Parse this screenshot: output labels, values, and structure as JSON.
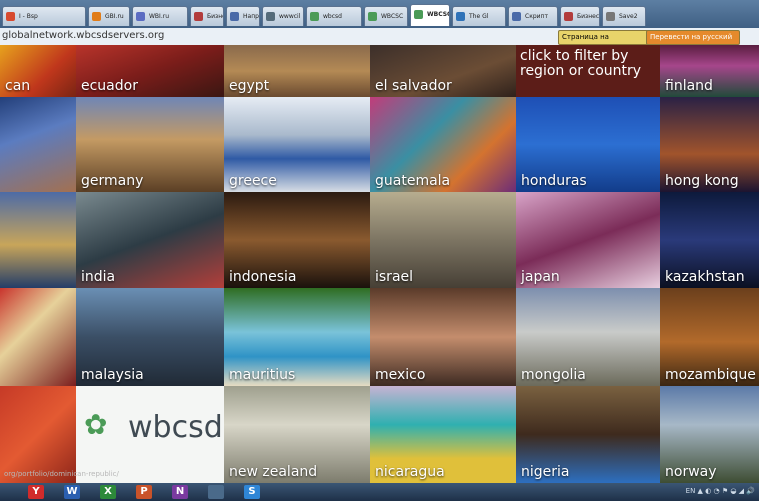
{
  "browser": {
    "tabs": [
      {
        "label": "I - Bsp",
        "color": "#d74a2f"
      },
      {
        "label": "GBI.ru",
        "color": "#e07c19"
      },
      {
        "label": "WBI.ru",
        "color": "#5b6cc2"
      },
      {
        "label": "Бизнес",
        "color": "#b23c3c"
      },
      {
        "label": "Напр.",
        "color": "#4a6aa8"
      },
      {
        "label": "wwwcil",
        "color": "#556b7a"
      },
      {
        "label": "wbcsd",
        "color": "#4b9b57"
      },
      {
        "label": "WBCSC",
        "color": "#4b9b57"
      },
      {
        "label": "WBCSC",
        "color": "#4b9b57",
        "active": true
      },
      {
        "label": "The Gl",
        "color": "#2f72b8"
      },
      {
        "label": "Скрипт",
        "color": "#4a6aa8"
      },
      {
        "label": "Бизнес",
        "color": "#b23c3c"
      },
      {
        "label": "Save2",
        "color": "#777"
      }
    ],
    "url": "globalnetwork.wbcsdservers.org",
    "translate_buttons": [
      "Страница на английском",
      "Перевести на русский"
    ]
  },
  "tiles": [
    {
      "label": "can",
      "bg": "linear-gradient(135deg,#e7a21d,#c0371c 60%,#7a2413)"
    },
    {
      "label": "ecuador",
      "bg": "linear-gradient(160deg,#b8342b,#7b1d1a 50%,#3a1612)"
    },
    {
      "label": "egypt",
      "bg": "linear-gradient(180deg,#8a6a4c,#b48a55 50%,#6a4a30)"
    },
    {
      "label": "el salvador",
      "bg": "linear-gradient(160deg,#3c2f2a,#6b4d35 60%,#2f211b)"
    },
    {
      "cta": "click to filter by region or country"
    },
    {
      "label": "finland",
      "bg": "linear-gradient(180deg,#5a1e40,#a6468b 40%,#214a3a)"
    },
    {
      "label": "",
      "bg": "linear-gradient(160deg,#233f7a,#5b7cc0 40%,#a37050)"
    },
    {
      "label": "germany",
      "bg": "linear-gradient(180deg,#6f86b6,#c49a63 45%,#5b3f25)"
    },
    {
      "label": "greece",
      "bg": "linear-gradient(180deg,#e6ecf4,#a9b9cc 40%,#2f5aa5 65%,#d7dde4)"
    },
    {
      "label": "guatemala",
      "bg": "linear-gradient(135deg,#c13c7a,#3a8fa3 40%,#d4732f 70%,#6c2c78)"
    },
    {
      "label": "honduras",
      "bg": "linear-gradient(180deg,#1e4fb5,#2c6fd2 50%,#123c8a)"
    },
    {
      "label": "hong kong",
      "bg": "linear-gradient(180deg,#2a2145,#a1542c 60%,#1c1430)"
    },
    {
      "label": "",
      "bg": "linear-gradient(180deg,#4d6ba6,#c8a55a 55%,#243d68)"
    },
    {
      "label": "india",
      "bg": "linear-gradient(160deg,#7a8a8f,#2d3c45 50%,#b33f3a)"
    },
    {
      "label": "indonesia",
      "bg": "linear-gradient(180deg,#2b1a10,#8a5a2f 50%,#1a110c)"
    },
    {
      "label": "israel",
      "bg": "linear-gradient(180deg,#b7ad8f,#7d7563 50%,#463f35)"
    },
    {
      "label": "japan",
      "bg": "linear-gradient(160deg,#d8a4c8,#7b2c58 50%,#e8cfe0)"
    },
    {
      "label": "kazakhstan",
      "bg": "linear-gradient(180deg,#0d1a3c,#2a3a7a 50%,#0b1022)"
    },
    {
      "label": "",
      "bg": "linear-gradient(135deg,#c9342d,#e6d19a 40%,#7a1d1d)"
    },
    {
      "label": "malaysia",
      "bg": "linear-gradient(180deg,#6a8fb4,#3b4f66 50%,#202a36)"
    },
    {
      "label": "mauritius",
      "bg": "linear-gradient(180deg,#2f6d22,#7ac3d9 45%,#2f93c6 70%,#e6dcc2)"
    },
    {
      "label": "mexico",
      "bg": "linear-gradient(180deg,#5b3b2a,#c48d6d 50%,#3d2a22)"
    },
    {
      "label": "mongolia",
      "bg": "linear-gradient(180deg,#7d8fae,#c9cbc9 45%,#6b6a5b)"
    },
    {
      "label": "mozambique",
      "bg": "linear-gradient(180deg,#6b3f1c,#b26a2b 55%,#3a2612)"
    },
    {
      "label": "",
      "bg": "linear-gradient(135deg,#c63a27,#e35a32 50%,#8d2519)"
    },
    {
      "logo": "wbcsd"
    },
    {
      "label": "new zealand",
      "bg": "linear-gradient(180deg,#9fa08e,#d8d6c8 40%,#7d7c6d)"
    },
    {
      "label": "nicaragua",
      "bg": "linear-gradient(180deg,#c6b3d3,#2fb0b0 40%,#e0c03a 75%)"
    },
    {
      "label": "nigeria",
      "bg": "linear-gradient(180deg,#7a6140,#3e2a1d 50%,#2d6fc0)"
    },
    {
      "label": "norway",
      "bg": "linear-gradient(180deg,#5b7aa8,#a7b8c7 40%,#3e4d33)"
    }
  ],
  "status_url": "org/portfolio/dominican-republic/",
  "taskbar": {
    "apps": [
      {
        "glyph": "Y",
        "color": "#d12b2b"
      },
      {
        "glyph": "W",
        "color": "#2b5fb0"
      },
      {
        "glyph": "X",
        "color": "#2d8a3a"
      },
      {
        "glyph": "P",
        "color": "#c9532a"
      },
      {
        "glyph": "N",
        "color": "#7a3aa0"
      },
      {
        "glyph": "",
        "color": "#4a6a8a"
      },
      {
        "glyph": "S",
        "color": "#2f86d6"
      }
    ],
    "tray": "EN ▲ ◐ ◔ ⚑ ◒ ◢ 🔊"
  }
}
